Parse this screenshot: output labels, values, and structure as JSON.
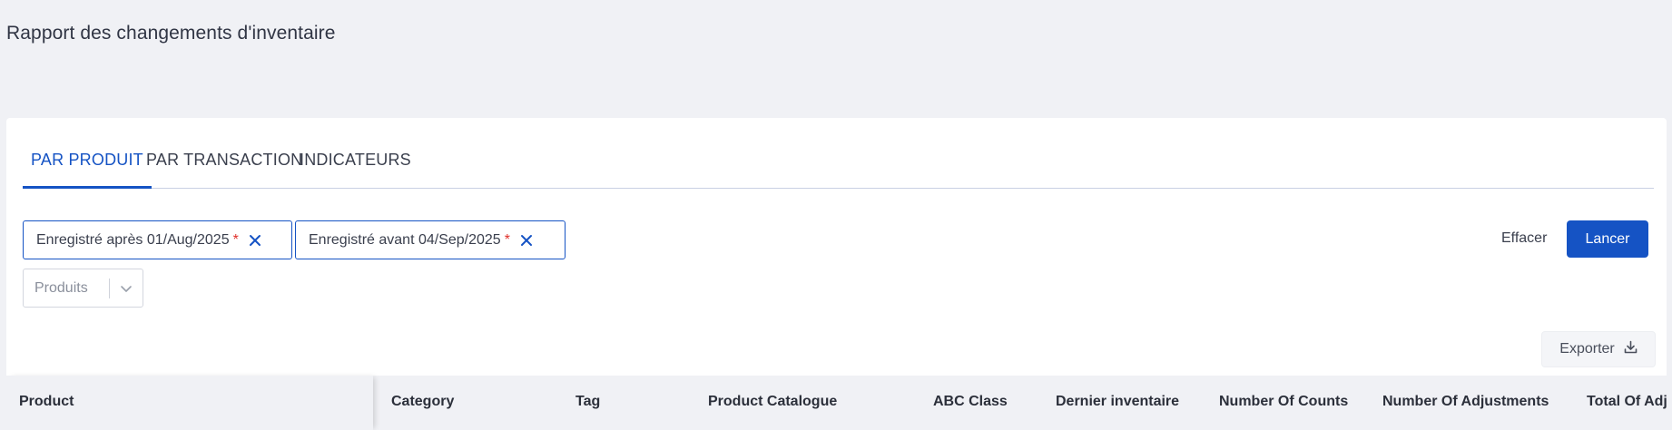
{
  "page": {
    "title": "Rapport des changements d'inventaire"
  },
  "tabs": [
    {
      "label": "PAR PRODUIT",
      "active": true
    },
    {
      "label": "PAR TRANSACTION",
      "active": false
    },
    {
      "label": "INDICATEURS",
      "active": false
    }
  ],
  "filters": {
    "chips": [
      {
        "label": "Enregistré après 01/Aug/2025",
        "required_mark": "*"
      },
      {
        "label": "Enregistré avant 04/Sep/2025",
        "required_mark": "*"
      }
    ],
    "products_select": {
      "placeholder": "Produits"
    },
    "clear_label": "Effacer",
    "run_label": "Lancer"
  },
  "toolbar": {
    "export_label": "Exporter"
  },
  "table": {
    "columns": [
      "Product",
      "Category",
      "Tag",
      "Product Catalogue",
      "ABC Class",
      "Dernier inventaire",
      "Number Of Counts",
      "Number Of Adjustments",
      "Total Of Adj"
    ]
  },
  "colors": {
    "accent": "#1553c4",
    "required": "#e0302a",
    "background": "#f0f1f5"
  }
}
